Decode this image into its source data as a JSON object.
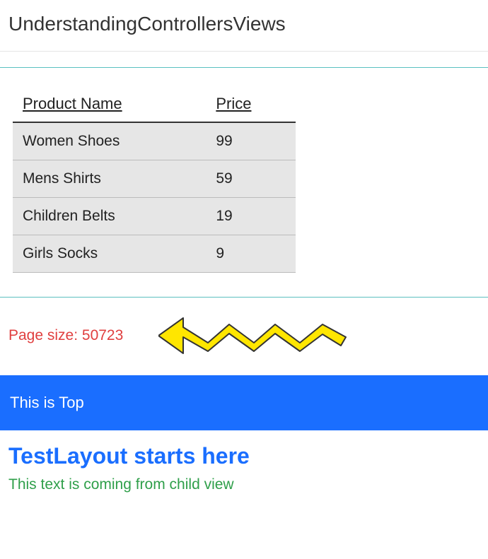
{
  "header": {
    "title": "UnderstandingControllersViews"
  },
  "table": {
    "headers": [
      "Product Name",
      "Price"
    ],
    "rows": [
      {
        "name": "Women Shoes",
        "price": "99"
      },
      {
        "name": "Mens Shirts",
        "price": "59"
      },
      {
        "name": "Children Belts",
        "price": "19"
      },
      {
        "name": "Girls Socks",
        "price": "9"
      }
    ]
  },
  "page_size": {
    "label": "Page size: 50723"
  },
  "banner": {
    "top_text": "This is Top"
  },
  "layout": {
    "heading": "TestLayout starts here",
    "child_text": "This text is coming from child view"
  }
}
